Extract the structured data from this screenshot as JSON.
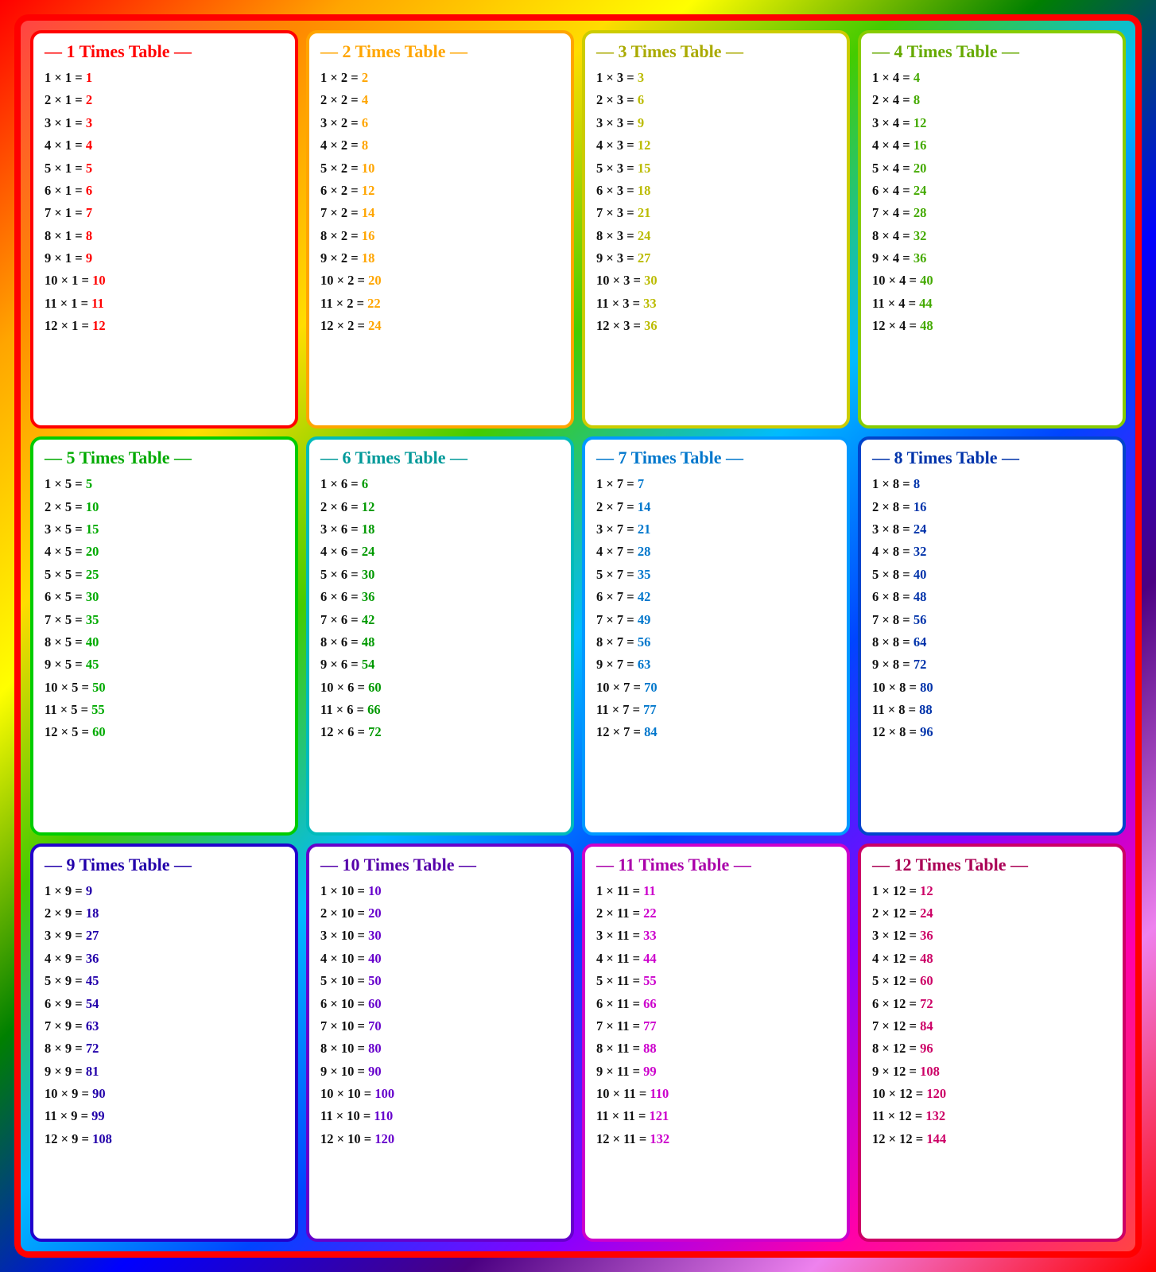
{
  "tables": [
    {
      "id": 1,
      "label": "1 Times Table",
      "cardClass": "card-1",
      "resultClass": "r1",
      "rows": [
        {
          "eq": "1 × 1 = ",
          "res": "1"
        },
        {
          "eq": "2 × 1 = ",
          "res": "2"
        },
        {
          "eq": "3 × 1 = ",
          "res": "3"
        },
        {
          "eq": "4 × 1 = ",
          "res": "4"
        },
        {
          "eq": "5 × 1 = ",
          "res": "5"
        },
        {
          "eq": "6 × 1 = ",
          "res": "6"
        },
        {
          "eq": "7 × 1 = ",
          "res": "7"
        },
        {
          "eq": "8 × 1 = ",
          "res": "8"
        },
        {
          "eq": "9 × 1 = ",
          "res": "9"
        },
        {
          "eq": "10 × 1 = ",
          "res": "10"
        },
        {
          "eq": "11 × 1 = ",
          "res": "11"
        },
        {
          "eq": "12 × 1 = ",
          "res": "12"
        }
      ]
    },
    {
      "id": 2,
      "label": "2 Times Table",
      "cardClass": "card-2",
      "resultClass": "r2",
      "rows": [
        {
          "eq": "1 × 2 = ",
          "res": "2"
        },
        {
          "eq": "2 × 2 = ",
          "res": "4"
        },
        {
          "eq": "3 × 2 = ",
          "res": "6"
        },
        {
          "eq": "4 × 2 = ",
          "res": "8"
        },
        {
          "eq": "5 × 2 = ",
          "res": "10"
        },
        {
          "eq": "6 × 2 = ",
          "res": "12"
        },
        {
          "eq": "7 × 2 = ",
          "res": "14"
        },
        {
          "eq": "8 × 2 = ",
          "res": "16"
        },
        {
          "eq": "9 × 2 = ",
          "res": "18"
        },
        {
          "eq": "10 × 2 = ",
          "res": "20"
        },
        {
          "eq": "11 × 2 = ",
          "res": "22"
        },
        {
          "eq": "12 × 2 = ",
          "res": "24"
        }
      ]
    },
    {
      "id": 3,
      "label": "3 Times Table",
      "cardClass": "card-3",
      "resultClass": "r3",
      "rows": [
        {
          "eq": "1 × 3 = ",
          "res": "3"
        },
        {
          "eq": "2 × 3 = ",
          "res": "6"
        },
        {
          "eq": "3 × 3 = ",
          "res": "9"
        },
        {
          "eq": "4 × 3 = ",
          "res": "12"
        },
        {
          "eq": "5 × 3 = ",
          "res": "15"
        },
        {
          "eq": "6 × 3 = ",
          "res": "18"
        },
        {
          "eq": "7 × 3 = ",
          "res": "21"
        },
        {
          "eq": "8 × 3 = ",
          "res": "24"
        },
        {
          "eq": "9 × 3 = ",
          "res": "27"
        },
        {
          "eq": "10 × 3 = ",
          "res": "30"
        },
        {
          "eq": "11 × 3 = ",
          "res": "33"
        },
        {
          "eq": "12 × 3 = ",
          "res": "36"
        }
      ]
    },
    {
      "id": 4,
      "label": "4 Times Table",
      "cardClass": "card-4",
      "resultClass": "r4",
      "rows": [
        {
          "eq": "1 × 4 = ",
          "res": "4"
        },
        {
          "eq": "2 × 4 = ",
          "res": "8"
        },
        {
          "eq": "3 × 4 = ",
          "res": "12"
        },
        {
          "eq": "4 × 4 = ",
          "res": "16"
        },
        {
          "eq": "5 × 4 = ",
          "res": "20"
        },
        {
          "eq": "6 × 4 = ",
          "res": "24"
        },
        {
          "eq": "7 × 4 = ",
          "res": "28"
        },
        {
          "eq": "8 × 4 = ",
          "res": "32"
        },
        {
          "eq": "9 × 4 = ",
          "res": "36"
        },
        {
          "eq": "10 × 4 = ",
          "res": "40"
        },
        {
          "eq": "11 × 4 = ",
          "res": "44"
        },
        {
          "eq": "12 × 4 = ",
          "res": "48"
        }
      ]
    },
    {
      "id": 5,
      "label": "5 Times Table",
      "cardClass": "card-5",
      "resultClass": "r5",
      "rows": [
        {
          "eq": "1 × 5 = ",
          "res": "5"
        },
        {
          "eq": "2 × 5 = ",
          "res": "10"
        },
        {
          "eq": "3 × 5 = ",
          "res": "15"
        },
        {
          "eq": "4 × 5 = ",
          "res": "20"
        },
        {
          "eq": "5 × 5 = ",
          "res": "25"
        },
        {
          "eq": "6 × 5 = ",
          "res": "30"
        },
        {
          "eq": "7 × 5 = ",
          "res": "35"
        },
        {
          "eq": "8 × 5 = ",
          "res": "40"
        },
        {
          "eq": "9 × 5 = ",
          "res": "45"
        },
        {
          "eq": "10 × 5 = ",
          "res": "50"
        },
        {
          "eq": "11 × 5 = ",
          "res": "55"
        },
        {
          "eq": "12 × 5 = ",
          "res": "60"
        }
      ]
    },
    {
      "id": 6,
      "label": "6 Times Table",
      "cardClass": "card-6",
      "resultClass": "r6",
      "rows": [
        {
          "eq": "1 × 6 = ",
          "res": "6"
        },
        {
          "eq": "2 × 6 = ",
          "res": "12"
        },
        {
          "eq": "3 × 6 = ",
          "res": "18"
        },
        {
          "eq": "4 × 6 = ",
          "res": "24"
        },
        {
          "eq": "5 × 6 = ",
          "res": "30"
        },
        {
          "eq": "6 × 6 = ",
          "res": "36"
        },
        {
          "eq": "7 × 6 = ",
          "res": "42"
        },
        {
          "eq": "8 × 6 = ",
          "res": "48"
        },
        {
          "eq": "9 × 6 = ",
          "res": "54"
        },
        {
          "eq": "10 × 6 = ",
          "res": "60"
        },
        {
          "eq": "11 × 6 = ",
          "res": "66"
        },
        {
          "eq": "12 × 6 = ",
          "res": "72"
        }
      ]
    },
    {
      "id": 7,
      "label": "7 Times Table",
      "cardClass": "card-7",
      "resultClass": "r7",
      "rows": [
        {
          "eq": "1 × 7 = ",
          "res": "7"
        },
        {
          "eq": "2 × 7 = ",
          "res": "14"
        },
        {
          "eq": "3 × 7 = ",
          "res": "21"
        },
        {
          "eq": "4 × 7 = ",
          "res": "28"
        },
        {
          "eq": "5 × 7 = ",
          "res": "35"
        },
        {
          "eq": "6 × 7 = ",
          "res": "42"
        },
        {
          "eq": "7 × 7 = ",
          "res": "49"
        },
        {
          "eq": "8 × 7 = ",
          "res": "56"
        },
        {
          "eq": "9 × 7 = ",
          "res": "63"
        },
        {
          "eq": "10 × 7 = ",
          "res": "70"
        },
        {
          "eq": "11 × 7 = ",
          "res": "77"
        },
        {
          "eq": "12 × 7 = ",
          "res": "84"
        }
      ]
    },
    {
      "id": 8,
      "label": "8 Times Table",
      "cardClass": "card-8",
      "resultClass": "r8",
      "rows": [
        {
          "eq": "1 × 8 = ",
          "res": "8"
        },
        {
          "eq": "2 × 8 = ",
          "res": "16"
        },
        {
          "eq": "3 × 8 = ",
          "res": "24"
        },
        {
          "eq": "4 × 8 = ",
          "res": "32"
        },
        {
          "eq": "5 × 8 = ",
          "res": "40"
        },
        {
          "eq": "6 × 8 = ",
          "res": "48"
        },
        {
          "eq": "7 × 8 = ",
          "res": "56"
        },
        {
          "eq": "8 × 8 = ",
          "res": "64"
        },
        {
          "eq": "9 × 8 = ",
          "res": "72"
        },
        {
          "eq": "10 × 8 = ",
          "res": "80"
        },
        {
          "eq": "11 × 8 = ",
          "res": "88"
        },
        {
          "eq": "12 × 8 = ",
          "res": "96"
        }
      ]
    },
    {
      "id": 9,
      "label": "9 Times Table",
      "cardClass": "card-9",
      "resultClass": "r9",
      "rows": [
        {
          "eq": "1 × 9 = ",
          "res": "9"
        },
        {
          "eq": "2 × 9 = ",
          "res": "18"
        },
        {
          "eq": "3 × 9 = ",
          "res": "27"
        },
        {
          "eq": "4 × 9 = ",
          "res": "36"
        },
        {
          "eq": "5 × 9 = ",
          "res": "45"
        },
        {
          "eq": "6 × 9 = ",
          "res": "54"
        },
        {
          "eq": "7 × 9 = ",
          "res": "63"
        },
        {
          "eq": "8 × 9 = ",
          "res": "72"
        },
        {
          "eq": "9 × 9 = ",
          "res": "81"
        },
        {
          "eq": "10 × 9 = ",
          "res": "90"
        },
        {
          "eq": "11 × 9 = ",
          "res": "99"
        },
        {
          "eq": "12 × 9 = ",
          "res": "108"
        }
      ]
    },
    {
      "id": 10,
      "label": "10 Times Table",
      "cardClass": "card-10",
      "resultClass": "r10",
      "rows": [
        {
          "eq": "1 × 10 = ",
          "res": "10"
        },
        {
          "eq": "2 × 10 = ",
          "res": "20"
        },
        {
          "eq": "3 × 10 = ",
          "res": "30"
        },
        {
          "eq": "4 × 10 = ",
          "res": "40"
        },
        {
          "eq": "5 × 10 = ",
          "res": "50"
        },
        {
          "eq": "6 × 10 = ",
          "res": "60"
        },
        {
          "eq": "7 × 10 = ",
          "res": "70"
        },
        {
          "eq": "8 × 10 = ",
          "res": "80"
        },
        {
          "eq": "9 × 10 = ",
          "res": "90"
        },
        {
          "eq": "10 × 10 = ",
          "res": "100"
        },
        {
          "eq": "11 × 10 = ",
          "res": "110"
        },
        {
          "eq": "12 × 10 = ",
          "res": "120"
        }
      ]
    },
    {
      "id": 11,
      "label": "11 Times Table",
      "cardClass": "card-11",
      "resultClass": "r11",
      "rows": [
        {
          "eq": "1 × 11 = ",
          "res": "11"
        },
        {
          "eq": "2 × 11 = ",
          "res": "22"
        },
        {
          "eq": "3 × 11 = ",
          "res": "33"
        },
        {
          "eq": "4 × 11 = ",
          "res": "44"
        },
        {
          "eq": "5 × 11 = ",
          "res": "55"
        },
        {
          "eq": "6 × 11 = ",
          "res": "66"
        },
        {
          "eq": "7 × 11 = ",
          "res": "77"
        },
        {
          "eq": "8 × 11 = ",
          "res": "88"
        },
        {
          "eq": "9 × 11 = ",
          "res": "99"
        },
        {
          "eq": "10 × 11 = ",
          "res": "110"
        },
        {
          "eq": "11 × 11 = ",
          "res": "121"
        },
        {
          "eq": "12 × 11 = ",
          "res": "132"
        }
      ]
    },
    {
      "id": 12,
      "label": "12 Times Table",
      "cardClass": "card-12",
      "resultClass": "r12",
      "rows": [
        {
          "eq": "1 × 12 = ",
          "res": "12"
        },
        {
          "eq": "2 × 12 = ",
          "res": "24"
        },
        {
          "eq": "3 × 12 = ",
          "res": "36"
        },
        {
          "eq": "4 × 12 = ",
          "res": "48"
        },
        {
          "eq": "5 × 12 = ",
          "res": "60"
        },
        {
          "eq": "6 × 12 = ",
          "res": "72"
        },
        {
          "eq": "7 × 12 = ",
          "res": "84"
        },
        {
          "eq": "8 × 12 = ",
          "res": "96"
        },
        {
          "eq": "9 × 12 = ",
          "res": "108"
        },
        {
          "eq": "10 × 12 = ",
          "res": "120"
        },
        {
          "eq": "11 × 12 = ",
          "res": "132"
        },
        {
          "eq": "12 × 12 = ",
          "res": "144"
        }
      ]
    }
  ]
}
